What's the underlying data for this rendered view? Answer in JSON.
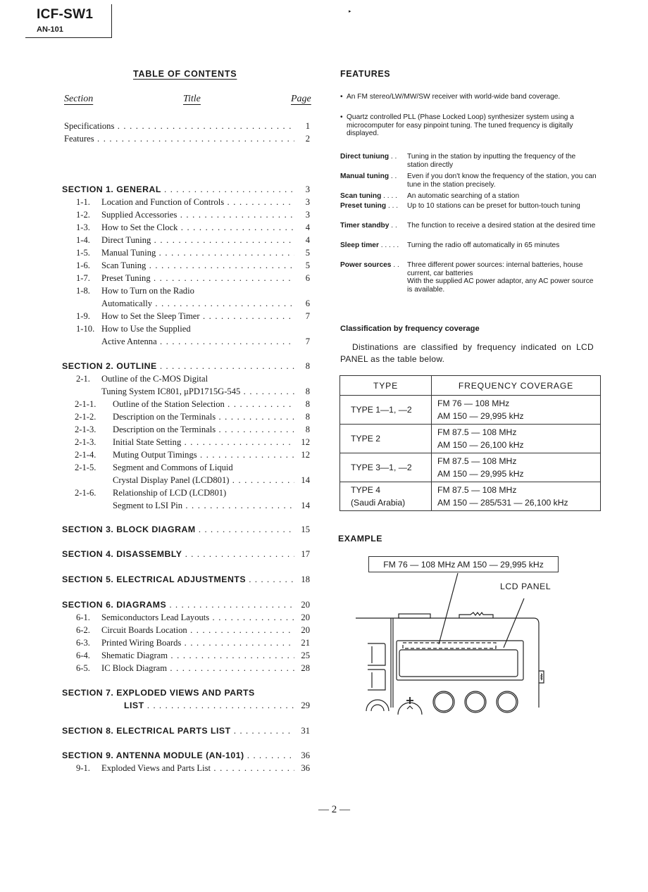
{
  "header": {
    "model": "ICF-SW1",
    "submodel": "AN-101"
  },
  "toc": {
    "title": "TABLE OF CONTENTS",
    "columns": {
      "section": "Section",
      "title": "Title",
      "page": "Page"
    },
    "entries": [
      {
        "num": "",
        "title": "Specifications",
        "page": "1"
      },
      {
        "num": "",
        "title": "Features",
        "page": "2"
      },
      {
        "num": "",
        "title": "SECTION 1. GENERAL",
        "page": "3"
      },
      {
        "num": "1-1.",
        "title": "Location and Function of Controls",
        "page": "3"
      },
      {
        "num": "1-2.",
        "title": "Supplied Accessories",
        "page": "3"
      },
      {
        "num": "1-3.",
        "title": "How to Set the Clock",
        "page": "4"
      },
      {
        "num": "1-4.",
        "title": "Direct Tuning",
        "page": "4"
      },
      {
        "num": "1-5.",
        "title": "Manual Tuning",
        "page": "5"
      },
      {
        "num": "1-6.",
        "title": "Scan Tuning",
        "page": "5"
      },
      {
        "num": "1-7.",
        "title": "Preset Tuning",
        "page": "6"
      },
      {
        "num": "1-8.",
        "title": "How to Turn on the Radio",
        "page": ""
      },
      {
        "num": "",
        "title": "Automatically",
        "page": "6"
      },
      {
        "num": "1-9.",
        "title": "How to Set the Sleep Timer",
        "page": "7"
      },
      {
        "num": "1-10.",
        "title": "How to Use the Supplied",
        "page": ""
      },
      {
        "num": "",
        "title": "Active Antenna",
        "page": "7"
      },
      {
        "num": "",
        "title": "SECTION 2. OUTLINE",
        "page": "8"
      },
      {
        "num": "2-1.",
        "title": "Outline of the C-MOS Digital",
        "page": ""
      },
      {
        "num": "",
        "title": "Tuning System IC801, μPD1715G-545",
        "page": "8"
      },
      {
        "num": "2-1-1.",
        "title": "Outline of the Station Selection",
        "page": "8"
      },
      {
        "num": "2-1-2.",
        "title": "Description on the Terminals",
        "page": "8"
      },
      {
        "num": "2-1-3.",
        "title": "Description on the Terminals",
        "page": "8"
      },
      {
        "num": "2-1-3.",
        "title": "Initial State Setting",
        "page": "12"
      },
      {
        "num": "2-1-4.",
        "title": "Muting Output Timings",
        "page": "12"
      },
      {
        "num": "2-1-5.",
        "title": "Segment and Commons of Liquid",
        "page": ""
      },
      {
        "num": "",
        "title": "Crystal Display Panel (LCD801)",
        "page": "14"
      },
      {
        "num": "2-1-6.",
        "title": "Relationship of LCD (LCD801)",
        "page": ""
      },
      {
        "num": "",
        "title": "Segment to LSI Pin",
        "page": "14"
      },
      {
        "num": "",
        "title": "SECTION 3. BLOCK DIAGRAM",
        "page": "15"
      },
      {
        "num": "",
        "title": "SECTION 4. DISASSEMBLY",
        "page": "17"
      },
      {
        "num": "",
        "title": "SECTION 5. ELECTRICAL ADJUSTMENTS",
        "page": "18"
      },
      {
        "num": "",
        "title": "SECTION 6. DIAGRAMS",
        "page": "20"
      },
      {
        "num": "6-1.",
        "title": "Semiconductors Lead Layouts",
        "page": "20"
      },
      {
        "num": "6-2.",
        "title": "Circuit Boards Location",
        "page": "20"
      },
      {
        "num": "6-3.",
        "title": "Printed Wiring Boards",
        "page": "21"
      },
      {
        "num": "6-4.",
        "title": "Shematic Diagram",
        "page": "25"
      },
      {
        "num": "6-5.",
        "title": "IC Block Diagram",
        "page": "28"
      },
      {
        "num": "",
        "title": "SECTION 7. EXPLODED VIEWS AND PARTS",
        "page": ""
      },
      {
        "num": "",
        "title": "LIST",
        "page": "29"
      },
      {
        "num": "",
        "title": "SECTION 8. ELECTRICAL PARTS LIST",
        "page": "31"
      },
      {
        "num": "",
        "title": "SECTION 9. ANTENNA MODULE (AN-101)",
        "page": "36"
      },
      {
        "num": "9-1.",
        "title": "Exploded Views and Parts List",
        "page": "36"
      }
    ]
  },
  "features": {
    "title": "FEATURES",
    "bullets": [
      "An FM stereo/LW/MW/SW receiver with world-wide band coverage.",
      "Quartz controlled PLL (Phase Locked Loop) synthesizer system using a microcomputer for easy pinpoint tuning. The tuned frequency is digitally displayed."
    ],
    "bullet_glyph": "•",
    "definitions": [
      {
        "term": "Direct tuniung",
        "leader": " . .",
        "desc": "Tuning in the station by inputting the frequency of the station directly"
      },
      {
        "term": "Manual tuning",
        "leader": " . .",
        "desc": "Even if you don't know the frequency of the station, you can tune in the station precisely."
      },
      {
        "term": "Scan tuning",
        "leader": " . . . .",
        "desc": "An automatic searching of a station"
      },
      {
        "term": "Preset tuning",
        "leader": " . . .",
        "desc": "Up to 10 stations can be preset for button-touch tuning"
      },
      {
        "term": "Timer standby",
        "leader": " . .",
        "desc": "The function to receive a desired station at the desired time"
      },
      {
        "term": "Sleep timer",
        "leader": " . . . . .",
        "desc": "Turning the radio off automatically in 65 minutes"
      },
      {
        "term": "Power sources",
        "leader": " . .",
        "desc": "Three different power sources: internal batteries, house current, car batteries\nWith the supplied AC power adaptor, any AC power source is available."
      }
    ]
  },
  "classification": {
    "title": "Classification by frequency coverage",
    "paragraph": "Distinations are classified by frequency indicated on LCD PANEL as the table below.",
    "table": {
      "headers": [
        "TYPE",
        "FREQUENCY COVERAGE"
      ],
      "rows": [
        {
          "type": "TYPE 1—1, —2",
          "type2": "",
          "fm": "FM 76 — 108 MHz",
          "am": "AM 150 — 29,995 kHz"
        },
        {
          "type": "TYPE 2",
          "type2": "",
          "fm": "FM 87.5 — 108 MHz",
          "am": "AM 150 — 26,100 kHz"
        },
        {
          "type": "TYPE 3—1, —2",
          "type2": "",
          "fm": "FM 87.5 — 108 MHz",
          "am": "AM 150 — 29,995 kHz"
        },
        {
          "type": "TYPE 4",
          "type2": "(Saudi Arabia)",
          "fm": "FM 87.5 — 108 MHz",
          "am": "AM 150 — 285/531 — 26,100 kHz"
        }
      ]
    }
  },
  "example": {
    "title": "EXAMPLE",
    "display_text": "FM 76 — 108 MHz  AM 150 — 29,995 kHz",
    "lcd_label": "LCD PANEL"
  },
  "page_number": "— 2 —"
}
